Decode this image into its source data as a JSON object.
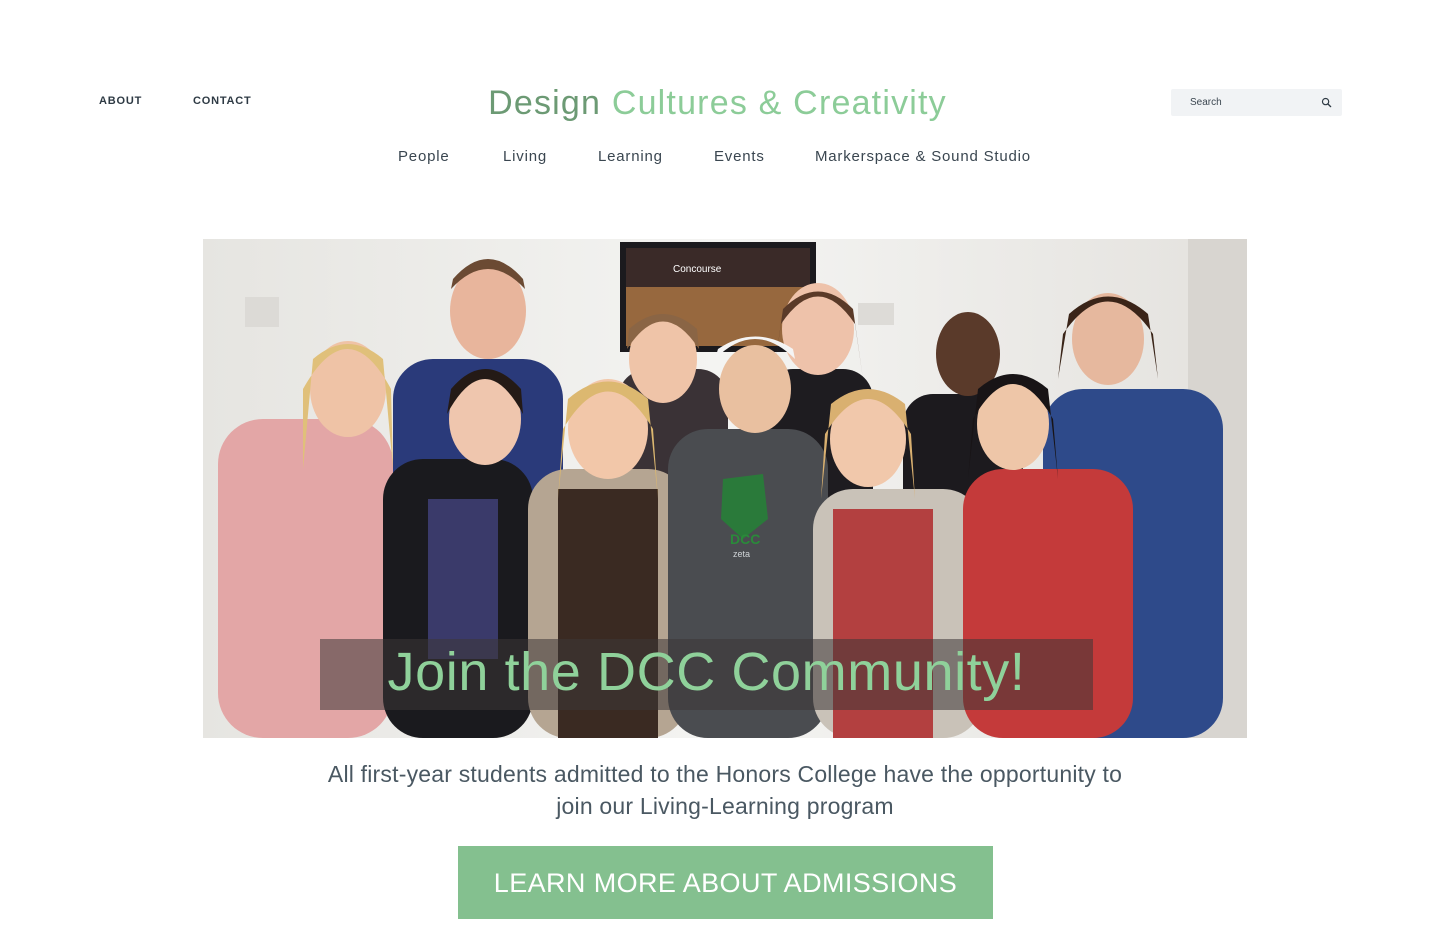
{
  "utility_nav": {
    "about": "ABOUT",
    "contact": "CONTACT"
  },
  "brand": {
    "part1": "Design",
    "part2": "Cultures & Creativity",
    "color_primary": "#6c9a74",
    "color_accent": "#8ccc98"
  },
  "search": {
    "placeholder": "Search",
    "icon": "search-icon"
  },
  "main_nav": {
    "items": [
      {
        "label": "People"
      },
      {
        "label": "Living"
      },
      {
        "label": "Learning"
      },
      {
        "label": "Events"
      },
      {
        "label": "Markerspace & Sound Studio"
      }
    ]
  },
  "hero": {
    "caption": "Join the DCC Community!",
    "shirt_text": "DCC",
    "shirt_subtext": "zeta",
    "screen_text": "Concourse"
  },
  "intro": {
    "tagline_line1": "All first-year students admitted to the Honors College have the opportunity to",
    "tagline_line2": "join our Living-Learning program"
  },
  "cta": {
    "label": "LEARN MORE ABOUT ADMISSIONS",
    "color": "#84c08f"
  }
}
